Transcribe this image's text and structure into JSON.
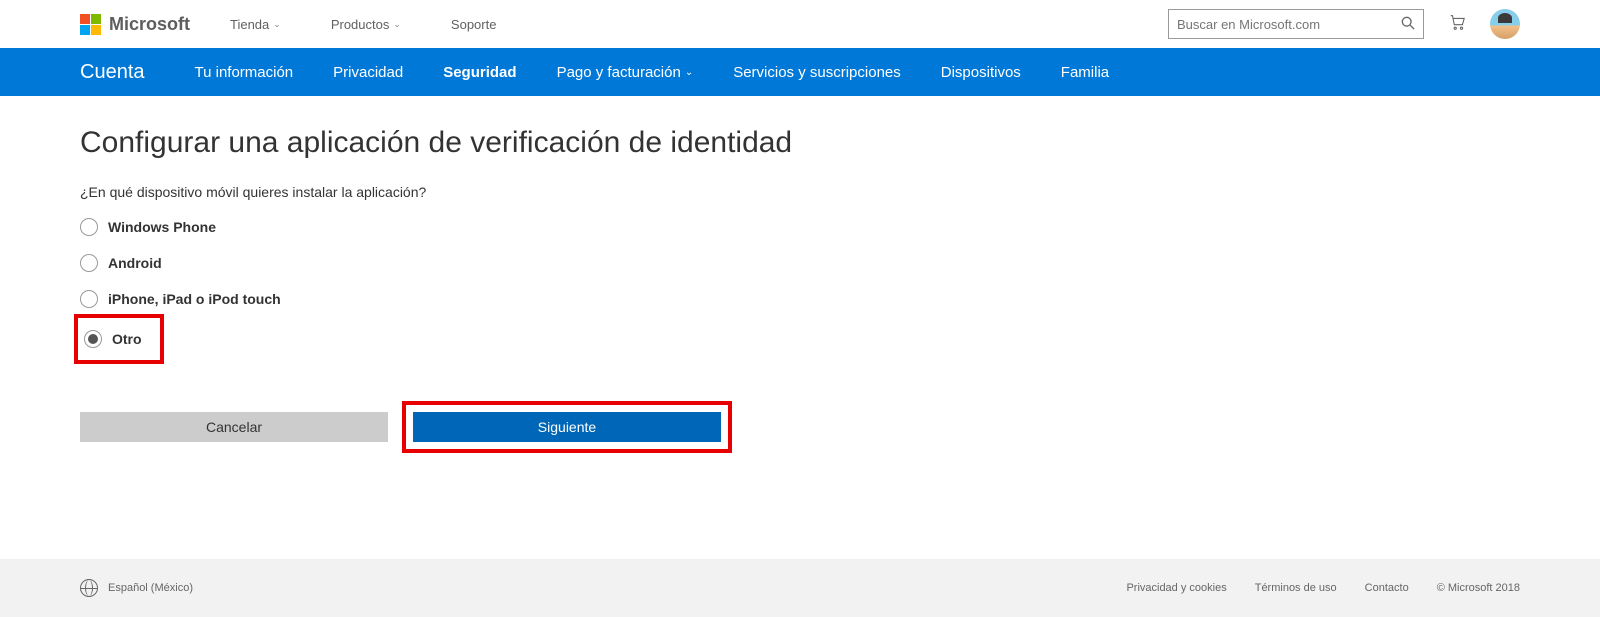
{
  "header": {
    "brand": "Microsoft",
    "menu": [
      {
        "label": "Tienda",
        "dropdown": true
      },
      {
        "label": "Productos",
        "dropdown": true
      },
      {
        "label": "Soporte",
        "dropdown": false
      }
    ],
    "search_placeholder": "Buscar en Microsoft.com"
  },
  "subnav": {
    "brand": "Cuenta",
    "items": [
      {
        "label": "Tu información",
        "active": false,
        "dropdown": false
      },
      {
        "label": "Privacidad",
        "active": false,
        "dropdown": false
      },
      {
        "label": "Seguridad",
        "active": true,
        "dropdown": false
      },
      {
        "label": "Pago y facturación",
        "active": false,
        "dropdown": true
      },
      {
        "label": "Servicios y suscripciones",
        "active": false,
        "dropdown": false
      },
      {
        "label": "Dispositivos",
        "active": false,
        "dropdown": false
      },
      {
        "label": "Familia",
        "active": false,
        "dropdown": false
      }
    ]
  },
  "main": {
    "title": "Configurar una aplicación de verificación de identidad",
    "prompt": "¿En qué dispositivo móvil quieres instalar la aplicación?",
    "options": [
      {
        "label": "Windows Phone",
        "selected": false
      },
      {
        "label": "Android",
        "selected": false
      },
      {
        "label": "iPhone, iPad o iPod touch",
        "selected": false
      },
      {
        "label": "Otro",
        "selected": true
      }
    ],
    "cancel_label": "Cancelar",
    "next_label": "Siguiente"
  },
  "footer": {
    "locale": "Español (México)",
    "links": [
      "Privacidad y cookies",
      "Términos de uso",
      "Contacto"
    ],
    "copyright": "© Microsoft 2018"
  }
}
